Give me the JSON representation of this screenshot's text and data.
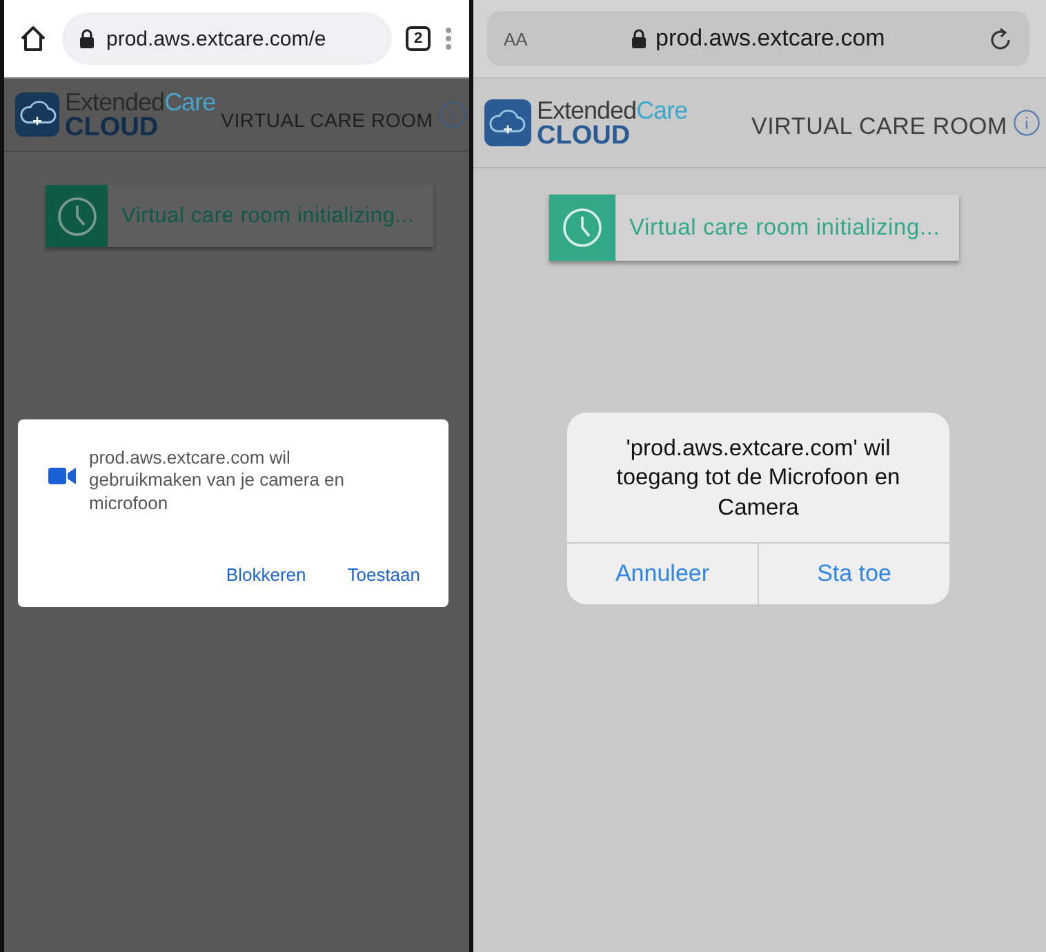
{
  "screens": [
    {
      "kind": "android",
      "address_bar": {
        "url": "prod.aws.extcare.com/e",
        "tab_count": "2"
      },
      "app_header": {
        "logo_word_1": "Extended",
        "logo_word_2": "Care",
        "logo_word_3": "CLOUD",
        "title": "VIRTUAL CARE ROOM"
      },
      "status_banner": {
        "text": "Virtual care room initializing..."
      },
      "permission_dialog": {
        "message": "prod.aws.extcare.com wil gebruikmaken van je camera en microfoon",
        "buttons": [
          "Blokkeren",
          "Toestaan"
        ]
      }
    },
    {
      "kind": "ios",
      "address_bar": {
        "text_size_label": "AA",
        "url": "prod.aws.extcare.com"
      },
      "app_header": {
        "logo_word_1": "Extended",
        "logo_word_2": "Care",
        "logo_word_3": "CLOUD",
        "title": "VIRTUAL CARE ROOM"
      },
      "status_banner": {
        "text": "Virtual care room initializing..."
      },
      "permission_dialog": {
        "message": "'prod.aws.extcare.com' wil toegang tot de Microfoon en Camera",
        "buttons": [
          "Annuleer",
          "Sta toe"
        ]
      }
    }
  ]
}
